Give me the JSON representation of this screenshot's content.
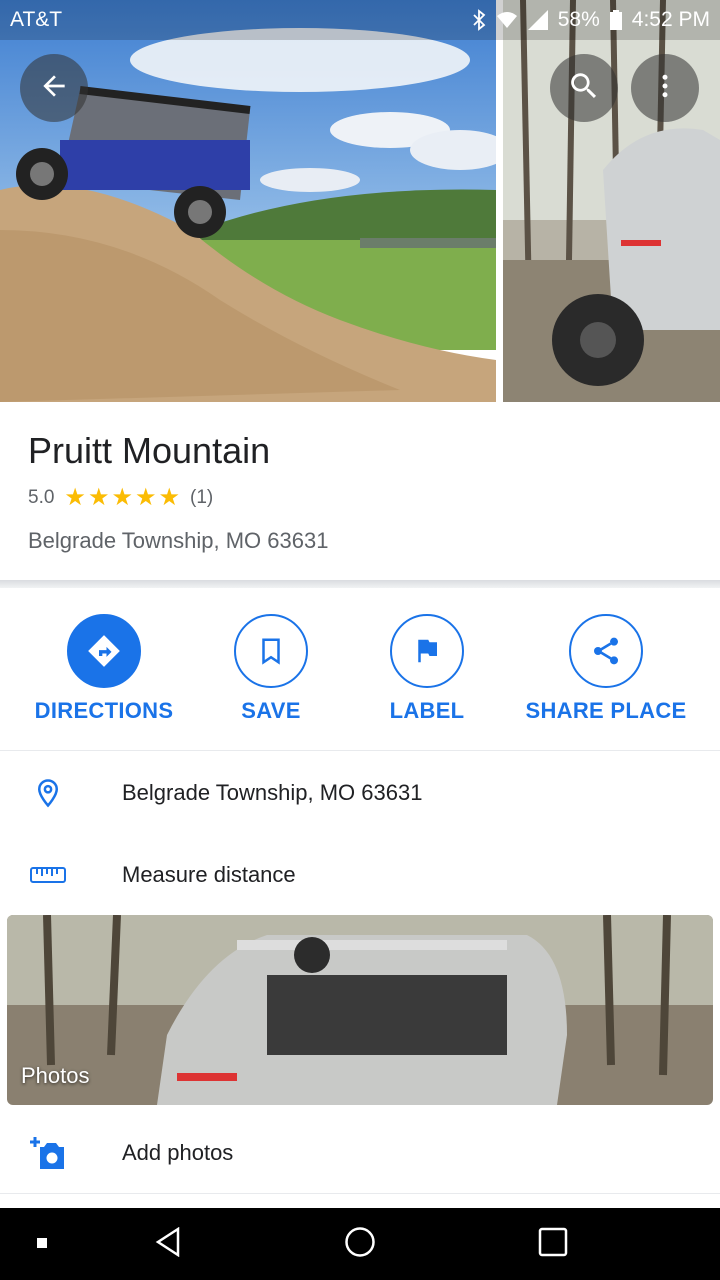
{
  "status_bar": {
    "carrier": "AT&T",
    "battery": "58%",
    "time": "4:52 PM"
  },
  "header": {
    "back_icon": "arrow-back-icon",
    "search_icon": "search-icon",
    "more_icon": "more-vert-icon"
  },
  "place": {
    "title": "Pruitt Mountain",
    "rating": "5.0",
    "stars": 5,
    "review_count": "(1)",
    "address": "Belgrade Township, MO 63631"
  },
  "actions": [
    {
      "label": "DIRECTIONS",
      "icon": "directions-icon"
    },
    {
      "label": "SAVE",
      "icon": "bookmark-icon"
    },
    {
      "label": "LABEL",
      "icon": "flag-icon"
    },
    {
      "label": "SHARE PLACE",
      "icon": "share-icon"
    }
  ],
  "details": {
    "address": "Belgrade Township, MO 63631",
    "measure": "Measure distance",
    "photos_label": "Photos",
    "add_photos": "Add photos"
  },
  "colors": {
    "accent": "#1a73e8",
    "star": "#fbbc04"
  }
}
